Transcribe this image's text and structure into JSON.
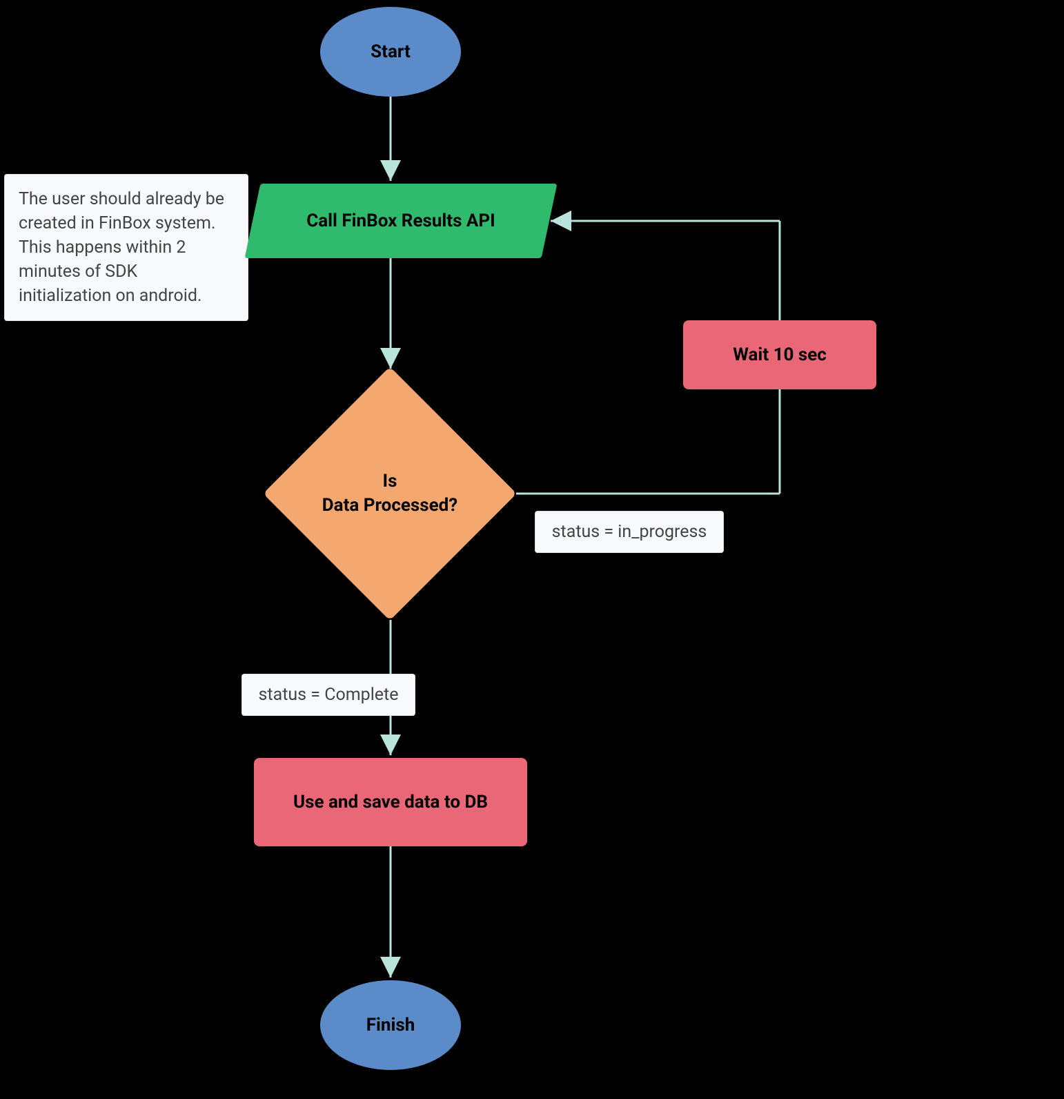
{
  "nodes": {
    "start": "Start",
    "call_api": "Call FinBox Results API",
    "decision_line1": "Is",
    "decision_line2": "Data Processed?",
    "wait": "Wait 10 sec",
    "save": "Use and save data to DB",
    "finish": "Finish"
  },
  "notes": {
    "user_created": "The user should already be created in FinBox system. This happens within 2 minutes of SDK initialization on android.",
    "status_in_progress": "status = in_progress",
    "status_complete": "status = Complete"
  },
  "colors": {
    "ellipse": "#5B8BC9",
    "process_green": "#2FBA6D",
    "decision": "#F4A86F",
    "action_red": "#E96776",
    "note_bg": "#F8F9FC",
    "arrow": "#B8E4DB"
  }
}
